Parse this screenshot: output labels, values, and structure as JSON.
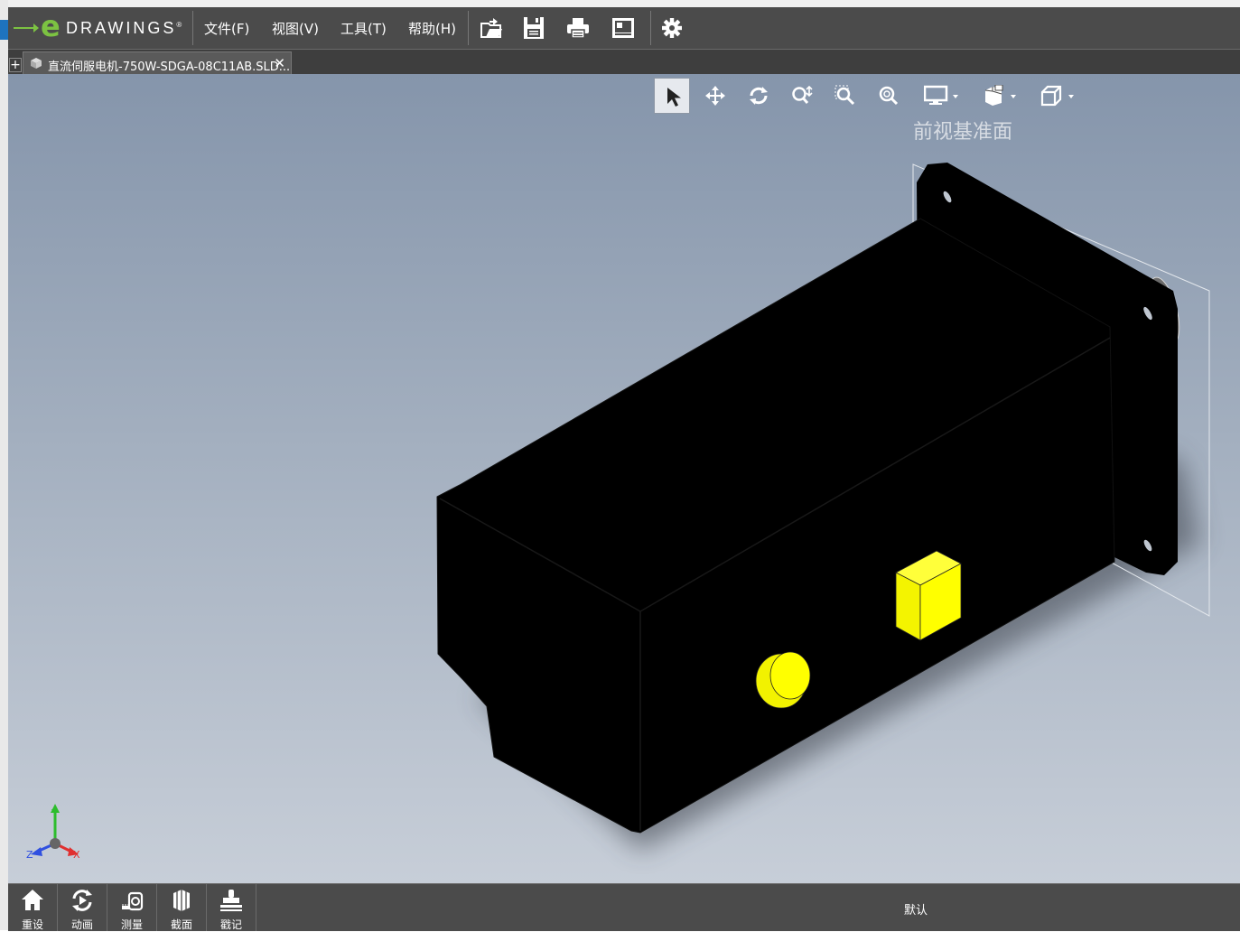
{
  "app": {
    "logo_text": "DRAWINGS",
    "logo_e": "e",
    "logo_reg": "®"
  },
  "menu": {
    "file": "文件(F)",
    "view": "视图(V)",
    "tools": "工具(T)",
    "help": "帮助(H)"
  },
  "toolbar_icons": [
    "open-icon",
    "save-icon",
    "print-icon",
    "sheet-icon",
    "settings-icon"
  ],
  "tabs": [
    {
      "label": "直流伺服电机-750W-SDGA-08C11AB.SLD...",
      "close": "✕"
    }
  ],
  "add_tab": "+",
  "view_toolbar": [
    "select-icon",
    "pan-icon",
    "rotate-icon",
    "zoom-icon",
    "zoom-to-area-icon",
    "zoom-to-fit-icon",
    "display-icon",
    "view-orientation-icon",
    "standard-views-icon"
  ],
  "viewport": {
    "plane_label": "前视基准面",
    "axis_x": "X",
    "axis_y": "Y",
    "axis_z": "Z"
  },
  "bottom_buttons": [
    {
      "label": "重设",
      "icon": "home-icon"
    },
    {
      "label": "动画",
      "icon": "animate-icon"
    },
    {
      "label": "测量",
      "icon": "measure-icon"
    },
    {
      "label": "截面",
      "icon": "section-icon"
    },
    {
      "label": "戳记",
      "icon": "stamp-icon"
    }
  ],
  "configuration": "默认",
  "colors": {
    "accent": "#7cc242",
    "chrome": "#4b4b4b",
    "model": "#000000",
    "highlight": "#ffff00"
  }
}
